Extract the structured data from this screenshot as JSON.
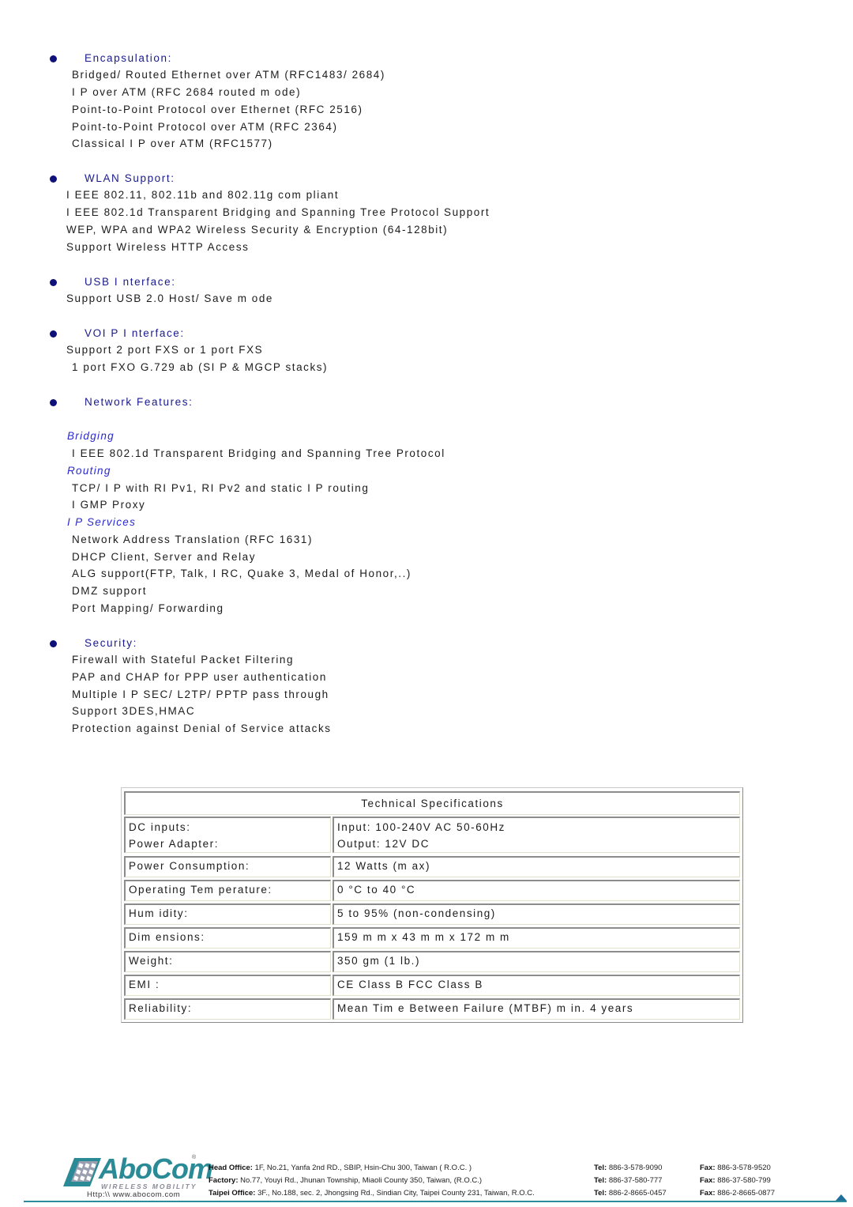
{
  "sections": {
    "encapsulation": {
      "heading": "Encapsulation:",
      "lines": [
        "Bridged/ Routed Ethernet over ATM (RFC1483/ 2684)",
        "I P over ATM (RFC 2684 routed m ode)",
        "Point-to-Point Protocol over Ethernet (RFC 2516)",
        "Point-to-Point Protocol over ATM (RFC 2364)",
        "Classical I P over ATM (RFC1577)"
      ]
    },
    "wlan": {
      "heading": "WLAN Support:",
      "lines": [
        "I EEE 802.11, 802.11b and 802.11g com pliant",
        "I EEE 802.1d Transparent Bridging and Spanning Tree Protocol Support",
        "WEP, WPA and WPA2 Wireless Security & Encryption (64-128bit)",
        "Support Wireless HTTP Access"
      ]
    },
    "usb": {
      "heading": "USB I nterface:",
      "lines": [
        "Support USB 2.0 Host/ Save m ode"
      ]
    },
    "voip": {
      "heading": "VOI P I nterface:",
      "lines": [
        "Support 2 port FXS or 1 port FXS",
        "1 port FXO G.729 ab (SI P & MGCP stacks)"
      ]
    },
    "network": {
      "heading": "Network Features:",
      "bridging": {
        "title": "Bridging",
        "lines": [
          "I EEE 802.1d Transparent Bridging and Spanning Tree Protocol"
        ]
      },
      "routing": {
        "title": "Routing",
        "lines": [
          "TCP/ I P with RI Pv1, RI Pv2 and static I P routing",
          "I GMP Proxy"
        ]
      },
      "ip_services": {
        "title": "I P Services",
        "lines": [
          "Network Address Translation (RFC 1631)",
          "DHCP Client, Server and Relay",
          "ALG support(FTP, Talk, I RC, Quake 3, Medal of Honor,..)",
          "DMZ support",
          "Port Mapping/ Forwarding"
        ]
      }
    },
    "security": {
      "heading": "Security:",
      "lines": [
        "Firewall with Stateful Packet Filtering",
        "PAP and CHAP for PPP user authentication",
        "Multiple I P SEC/ L2TP/ PPTP pass through",
        "Support 3DES,HMAC",
        "Protection against Denial of Service attacks"
      ]
    }
  },
  "spec_table": {
    "title": "Technical Specifications",
    "rows": [
      {
        "label": [
          "DC inputs:",
          "Power Adapter:"
        ],
        "value": [
          "Input: 100-240V AC 50-60Hz",
          "Output: 12V DC"
        ]
      },
      {
        "label": [
          "Power Consumption:"
        ],
        "value": [
          "12 Watts (m ax)"
        ]
      },
      {
        "label": [
          "Operating Tem perature:"
        ],
        "value": [
          "0 °C to 40 °C"
        ]
      },
      {
        "label": [
          "Hum idity:"
        ],
        "value": [
          "5 to 95%  (non-condensing)"
        ]
      },
      {
        "label": [
          "Dim ensions:"
        ],
        "value": [
          "159 m m  x 43 m m  x 172 m m"
        ]
      },
      {
        "label": [
          "Weight:"
        ],
        "value": [
          "350 gm  (1 lb.)"
        ]
      },
      {
        "label": [
          "EMI :"
        ],
        "value": [
          "CE Class B FCC Class B"
        ]
      },
      {
        "label": [
          "Reliability:"
        ],
        "value": [
          "Mean Tim e Between Failure (MTBF) m in. 4 years"
        ]
      }
    ]
  },
  "footer": {
    "brand": "AboCom",
    "registered": "®",
    "tagline": "WIRELESS MOBILITY",
    "url": "Http:\\\\ www.abocom.com",
    "offices": [
      {
        "label": "Head Office:",
        "address": "1F, No.21, Yanfa 2nd RD., SBIP, Hsin-Chu 300, Taiwan ( R.O.C. )",
        "tel_label": "Tel:",
        "tel": "886-3-578-9090",
        "fax_label": "Fax:",
        "fax": "886-3-578-9520"
      },
      {
        "label": "Factory:",
        "address": "No.77, Youyi Rd., Jhunan Township, Miaoli County 350, Taiwan, (R.O.C.)",
        "tel_label": "Tel:",
        "tel": "886-37-580-777",
        "fax_label": "Fax:",
        "fax": "886-37-580-799"
      },
      {
        "label": "Taipei Office:",
        "address": "3F., No.188, sec. 2, Jhongsing Rd., Sindian City, Taipei County 231, Taiwan, R.O.C.",
        "tel_label": "Tel:",
        "tel": "886-2-8665-0457",
        "fax_label": "Fax:",
        "fax": "886-2-8665-0877"
      }
    ]
  },
  "colors": {
    "heading": "#1a1a8c",
    "subheading": "#2a2ad0",
    "body_text": "#1c1c1c",
    "brand_teal": "#2a8a96"
  }
}
